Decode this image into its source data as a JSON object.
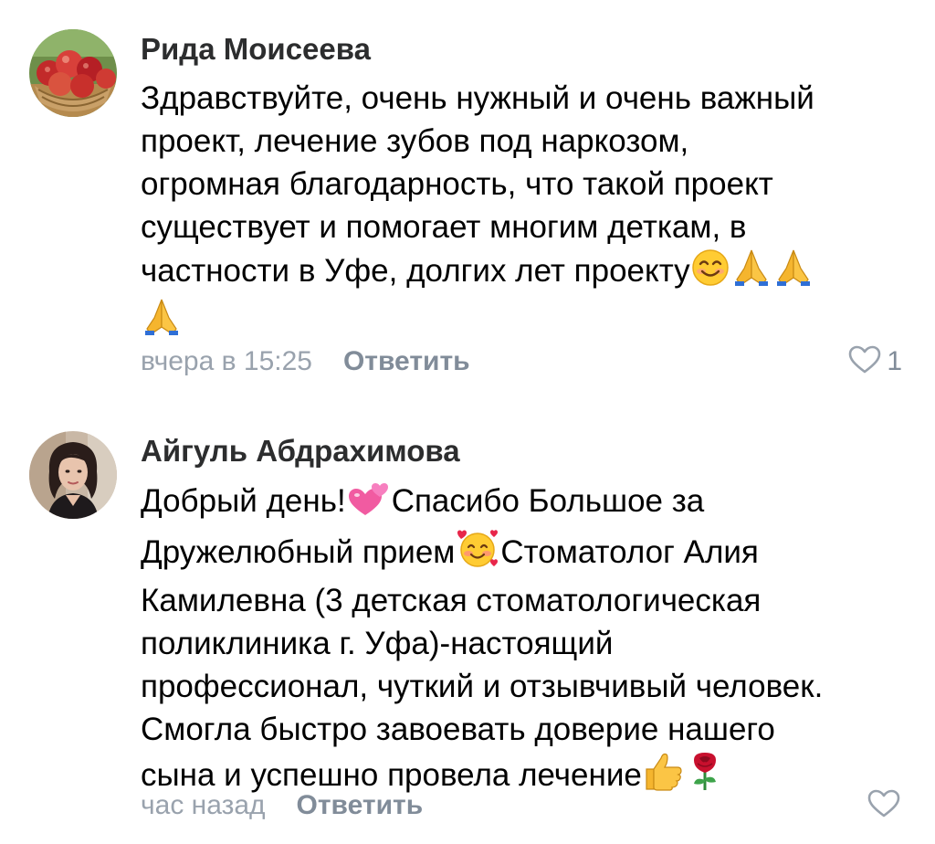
{
  "comments": [
    {
      "author": "Рида Моисеева",
      "avatar": "apples-basket-photo",
      "lines": [
        "Здравствуйте, очень нужный и очень важный",
        "проект, лечение зубов под наркозом,",
        "огромная благодарность, что такой проект",
        "существует и помогает многим деткам, в",
        "частности в Уфе, долгих лет проекту"
      ],
      "emojis_after": [
        "smiling-face-emoji",
        "folded-hands-emoji",
        "folded-hands-emoji",
        "folded-hands-emoji"
      ],
      "time": "вчера в 15:25",
      "reply_label": "Ответить",
      "like_count": "1"
    },
    {
      "author": "Айгуль Абдрахимова",
      "avatar": "woman-portrait-photo",
      "line1_a": "Добрый день!",
      "line1_b": "Спасибо Большое за",
      "line2_a": "Дружелюбный прием",
      "line2_b": "Стоматолог Алия",
      "line3": "Камилевна (3 детская стоматологическая",
      "line4": "поликлиника г. Уфа)-настоящий",
      "line5": "профессионал, чуткий и отзывчивый человек.",
      "line6": "Смогла быстро завоевать доверие нашего",
      "line7": "сына и успешно провела лечение",
      "emojis": [
        "two-hearts-emoji",
        "smiling-face-with-hearts-emoji",
        "thumbs-up-emoji",
        "rose-emoji"
      ],
      "time": "час назад",
      "reply_label": "Ответить",
      "like_count": ""
    }
  ],
  "colors": {
    "author": "#2c2d2e",
    "text": "#000000",
    "meta": "#99a2ad",
    "reply": "#818c99",
    "like_icon": "#99a2ad"
  }
}
